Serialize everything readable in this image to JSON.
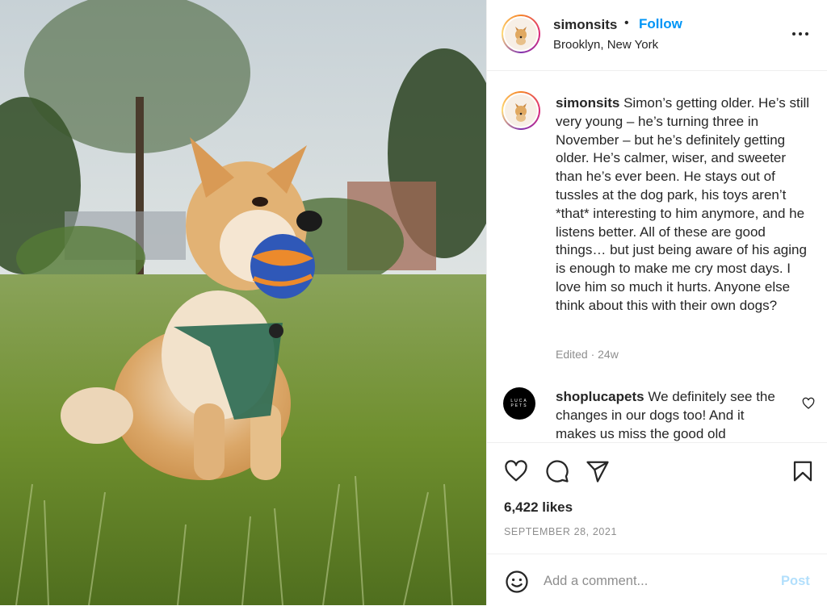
{
  "post": {
    "username": "simonsits",
    "separator": "•",
    "follow_label": "Follow",
    "location": "Brooklyn, New York",
    "caption": "Simon’s getting older. He’s still very young – he’s turning three in November – but he’s definitely getting older. He’s calmer, wiser, and sweeter than he’s ever been. He stays out of tussles at the dog park, his toys aren’t *that* interesting to him anymore, and he listens better. All of these are good things… but just being aware of his aging is enough to make me cry most days. I love him so much it hurts. Anyone else think about this with their own dogs?",
    "caption_meta": "Edited · 24w",
    "likes": "6,422 likes",
    "date": "SEPTEMBER 28, 2021"
  },
  "comment": {
    "username": "shoplucapets",
    "avatar_text_top": "LUCA",
    "avatar_text_bottom": "PETS",
    "text": "We definitely see the changes in our dogs too! And it makes us miss the good old"
  },
  "add_comment": {
    "placeholder": "Add a comment...",
    "post_label": "Post"
  },
  "icons": {
    "more": "more-options-icon",
    "like": "heart-icon",
    "comment": "comment-icon",
    "share": "paper-plane-icon",
    "save": "bookmark-icon",
    "emoji": "smiley-icon"
  },
  "colors": {
    "follow": "#0095f6",
    "post_disabled": "#b2dffc",
    "muted": "#8e8e8e",
    "text": "#262626"
  }
}
